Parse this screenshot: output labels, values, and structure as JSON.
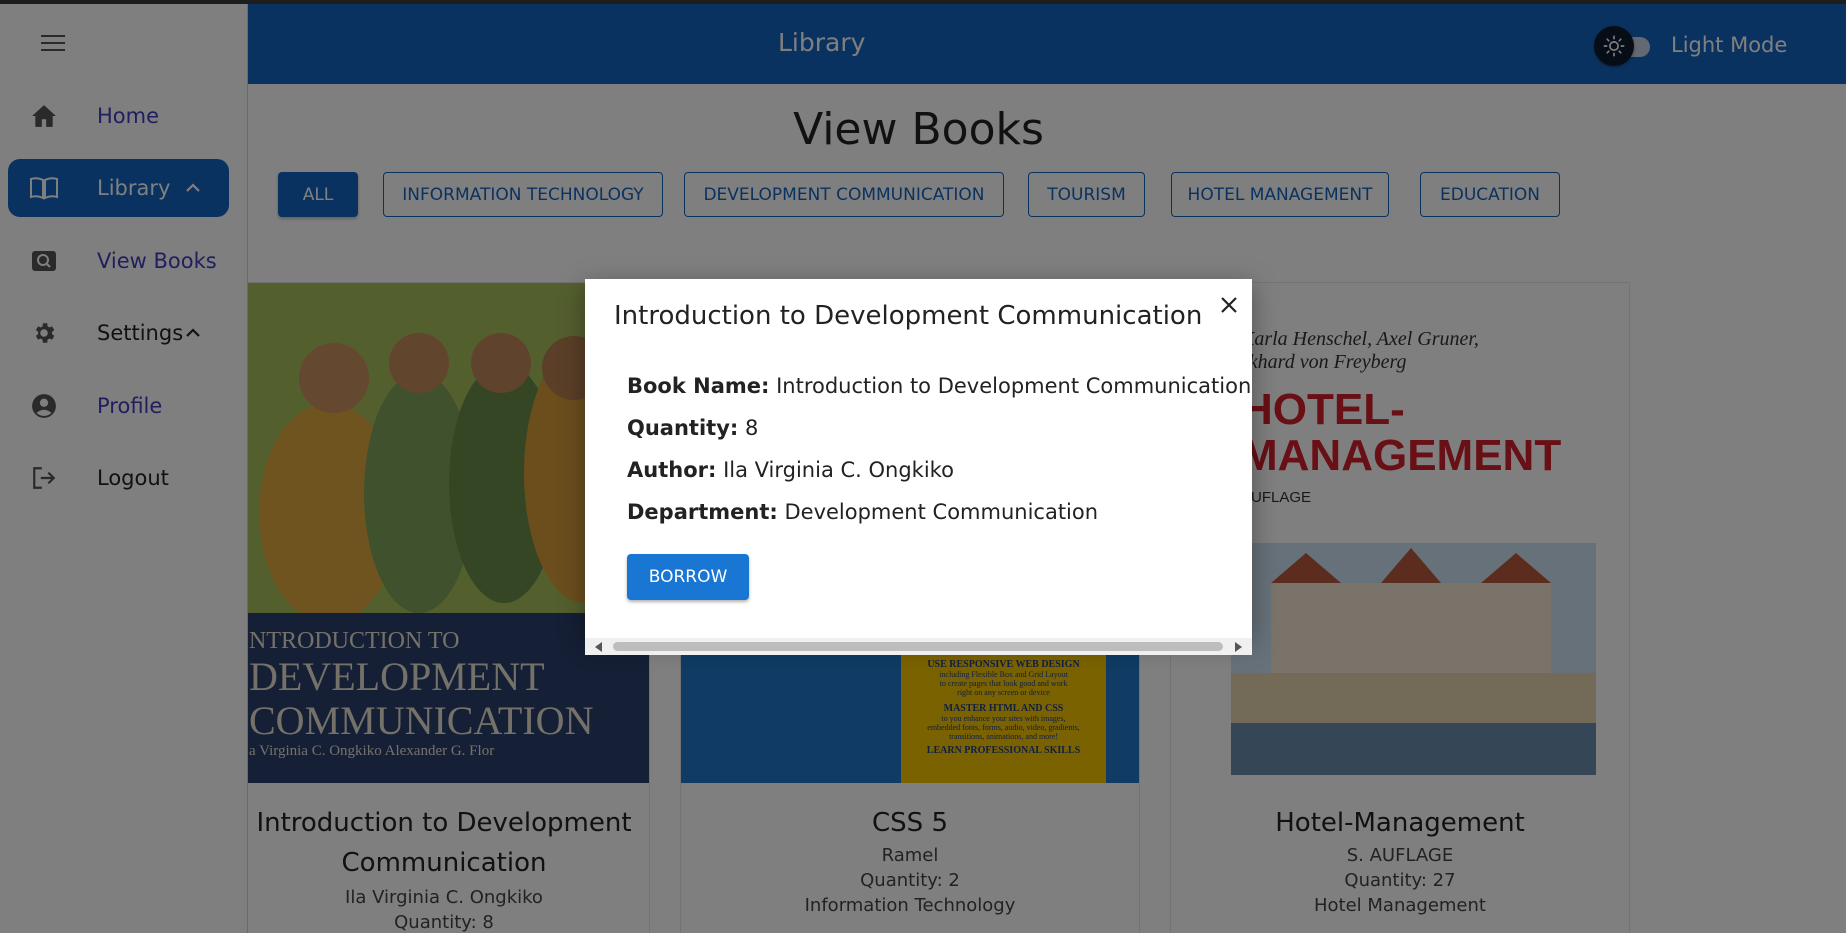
{
  "appbar": {
    "title": "Library",
    "mode_label": "Light Mode"
  },
  "sidebar": {
    "items": [
      {
        "label": "Home",
        "color": "#3f3fbf"
      },
      {
        "label": "Library",
        "color": "#ffffff"
      },
      {
        "label": "View Books",
        "color": "#3f3fbf"
      },
      {
        "label": "Settings",
        "color": "#222222"
      },
      {
        "label": "Profile",
        "color": "#3f3fbf"
      },
      {
        "label": "Logout",
        "color": "#222222"
      }
    ]
  },
  "main": {
    "title": "View Books",
    "filters": [
      "ALL",
      "INFORMATION TECHNOLOGY",
      "DEVELOPMENT COMMUNICATION",
      "TOURISM",
      "HOTEL MANAGEMENT",
      "EDUCATION"
    ],
    "cards": [
      {
        "title": "Introduction to Development Communication",
        "cover_lines": [
          "NTRODUCTION TO",
          "DEVELOPMENT",
          "COMMUNICATION",
          "a Virginia C. Ongkiko    Alexander G. Flor"
        ],
        "meta": [
          "Ila Virginia C. Ongkiko",
          "Quantity: 8"
        ]
      },
      {
        "title": "CSS 5",
        "cover_lines": [
          "USE RESPONSIVE WEB DESIGN",
          "including Flexible Box and Grid Layout",
          "to create pages that look good and work",
          "right on any screen or device",
          "MASTER HTML AND CSS",
          "to you enhance your sites with images,",
          "embedded fonts, forms, audio, video, gradients,",
          "transitions, animations, and more!",
          "LEARN PROFESSIONAL SKILLS"
        ],
        "meta": [
          "Ramel",
          "Quantity: 2",
          "Information Technology"
        ]
      },
      {
        "title": "Hotel-Management",
        "cover_lines": [
          "Karla Henschel, Axel Gruner,",
          "rkhard von Freyberg",
          "HOTEL-",
          "MANAGEMENT",
          "AUFLAGE"
        ],
        "meta": [
          "S. AUFLAGE",
          "Quantity: 27",
          "Hotel Management"
        ]
      }
    ]
  },
  "modal": {
    "title": "Introduction to Development Communication",
    "rows": [
      {
        "label": "Book Name:",
        "value": "Introduction to Development Communication"
      },
      {
        "label": "Quantity:",
        "value": "8"
      },
      {
        "label": "Author:",
        "value": "Ila Virginia C. Ongkiko"
      },
      {
        "label": "Department:",
        "value": "Development Communication"
      }
    ],
    "borrow_label": "BORROW"
  },
  "colors": {
    "primary": "#1565c0",
    "nav_link": "#3f3fbf",
    "overlay": "rgba(0,0,0,0.5)"
  }
}
